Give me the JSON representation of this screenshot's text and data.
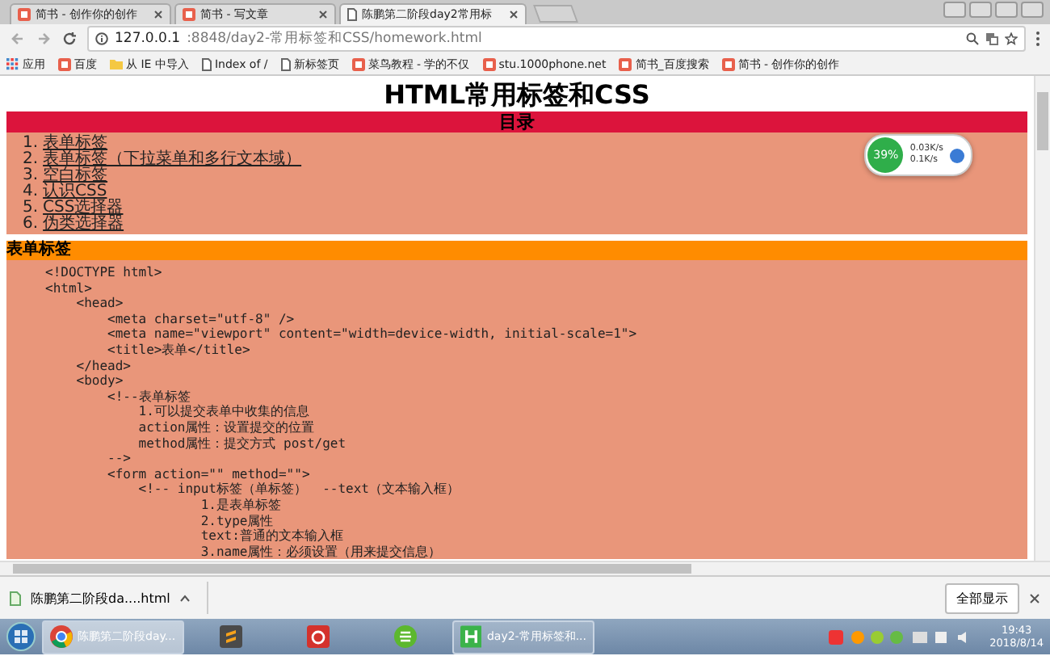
{
  "browser": {
    "tabs": [
      {
        "title": "简书 - 创作你的创作",
        "selected": false
      },
      {
        "title": "简书 - 写文章",
        "selected": false
      },
      {
        "title": "陈鹏第二阶段day2常用标",
        "selected": true
      }
    ],
    "address": {
      "host": "127.0.0.1",
      "path": ":8848/day2-常用标签和CSS/homework.html"
    },
    "bookmarks": [
      {
        "kind": "apps",
        "label": "应用"
      },
      {
        "kind": "site",
        "label": "百度"
      },
      {
        "kind": "folder",
        "label": "从 IE 中导入"
      },
      {
        "kind": "page",
        "label": "Index of /"
      },
      {
        "kind": "page",
        "label": "新标签页"
      },
      {
        "kind": "site",
        "label": "菜鸟教程 - 学的不仅"
      },
      {
        "kind": "site",
        "label": "stu.1000phone.net"
      },
      {
        "kind": "site",
        "label": "简书_百度搜索"
      },
      {
        "kind": "site",
        "label": "简书 - 创作你的创作"
      }
    ]
  },
  "widget": {
    "percent": "39%",
    "up": "0.03K/s",
    "down": "0.1K/s"
  },
  "page": {
    "title": "HTML常用标签和CSS",
    "toc": {
      "heading": "目录",
      "items": [
        {
          "number": "1.",
          "label": "表单标签"
        },
        {
          "number": "2.",
          "label": "表单标签（下拉菜单和多行文本域）"
        },
        {
          "number": "3.",
          "label": "空白标签"
        },
        {
          "number": "4.",
          "label": "认识CSS"
        },
        {
          "number": "5.",
          "label": "CSS选择器"
        },
        {
          "number": "6.",
          "label": "伪类选择器"
        }
      ]
    },
    "section": {
      "heading": "表单标签",
      "code": "<!DOCTYPE html>\n<html>\n\t<head>\n\t\t<meta charset=\"utf-8\" />\n\t\t<meta name=\"viewport\" content=\"width=device-width, initial-scale=1\">\n\t\t<title>表单</title>\n\t</head>\n\t<body>\n\t\t<!--表单标签\n\t\t\t1.可以提交表单中收集的信息\n\t\t\taction属性：设置提交的位置\n\t\t\tmethod属性：提交方式 post/get\n\t\t-->\n\t\t<form action=\"\" method=\"\">\n\t\t\t<!-- input标签（单标签）  --text（文本输入框）\n\t\t\t\t\t1.是表单标签\n\t\t\t\t\t2.type属性\n\t\t\t\t\ttext:普通的文本输入框\n\t\t\t\t\t3.name属性：必须设置（用来提交信息）"
    }
  },
  "downloads": {
    "file": "陈鹏第二阶段da....html",
    "show_all": "全部显示"
  },
  "taskbar": {
    "items": [
      {
        "kind": "browser",
        "label": "陈鹏第二阶段day...",
        "selected": true
      },
      {
        "kind": "editor",
        "selected": false
      },
      {
        "kind": "music",
        "selected": false
      },
      {
        "kind": "security",
        "selected": false
      },
      {
        "kind": "ide",
        "label": "day2-常用标签和...",
        "selected": false
      }
    ],
    "time": "19:43",
    "date": "2018/8/14"
  }
}
